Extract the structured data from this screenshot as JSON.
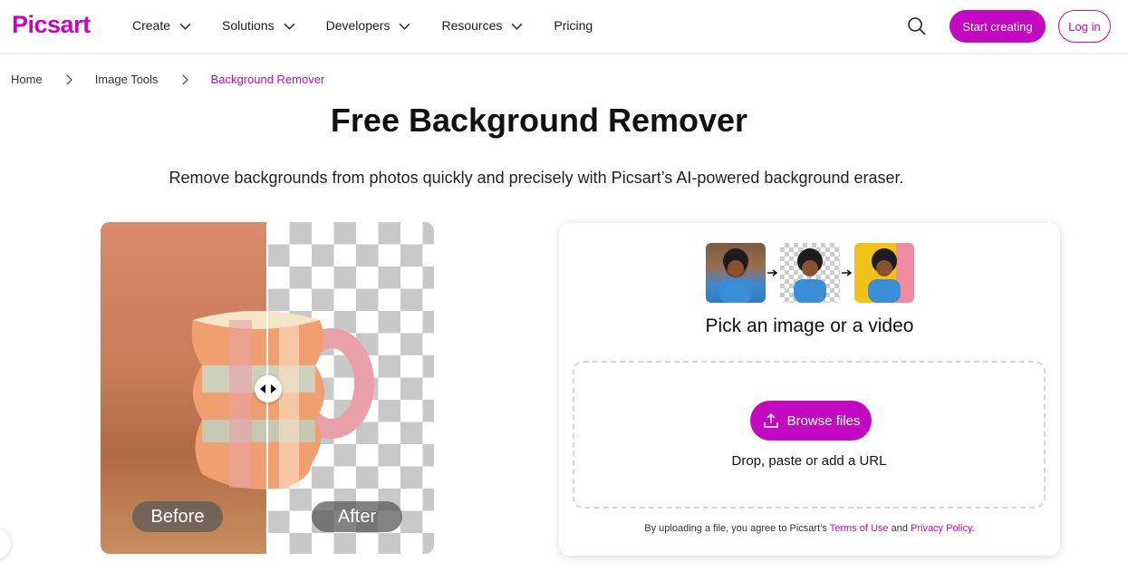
{
  "header": {
    "logo": "Picsart",
    "nav": [
      {
        "label": "Create",
        "has_dropdown": true
      },
      {
        "label": "Solutions",
        "has_dropdown": true
      },
      {
        "label": "Developers",
        "has_dropdown": true
      },
      {
        "label": "Resources",
        "has_dropdown": true
      },
      {
        "label": "Pricing",
        "has_dropdown": false
      }
    ],
    "search_icon": "search-icon",
    "start_button": "Start creating",
    "login_button": "Log in"
  },
  "breadcrumb": {
    "items": [
      "Home",
      "Image Tools",
      "Background Remover"
    ]
  },
  "hero": {
    "title": "Free Background Remover",
    "subtitle": "Remove backgrounds from photos quickly and precisely with Picsart’s AI-powered background eraser."
  },
  "compare": {
    "before_label": "Before",
    "after_label": "After"
  },
  "upload": {
    "title": "Pick an image or a video",
    "browse_button": "Browse files",
    "drop_text": "Drop, paste or add a URL",
    "terms_prefix": "By uploading a file, you agree to Picsart’s ",
    "terms_link": "Terms of Use",
    "terms_and": " and ",
    "privacy_link": "Privacy Policy",
    "terms_suffix": "."
  },
  "colors": {
    "brand": "#c209c1",
    "text": "#111111"
  }
}
